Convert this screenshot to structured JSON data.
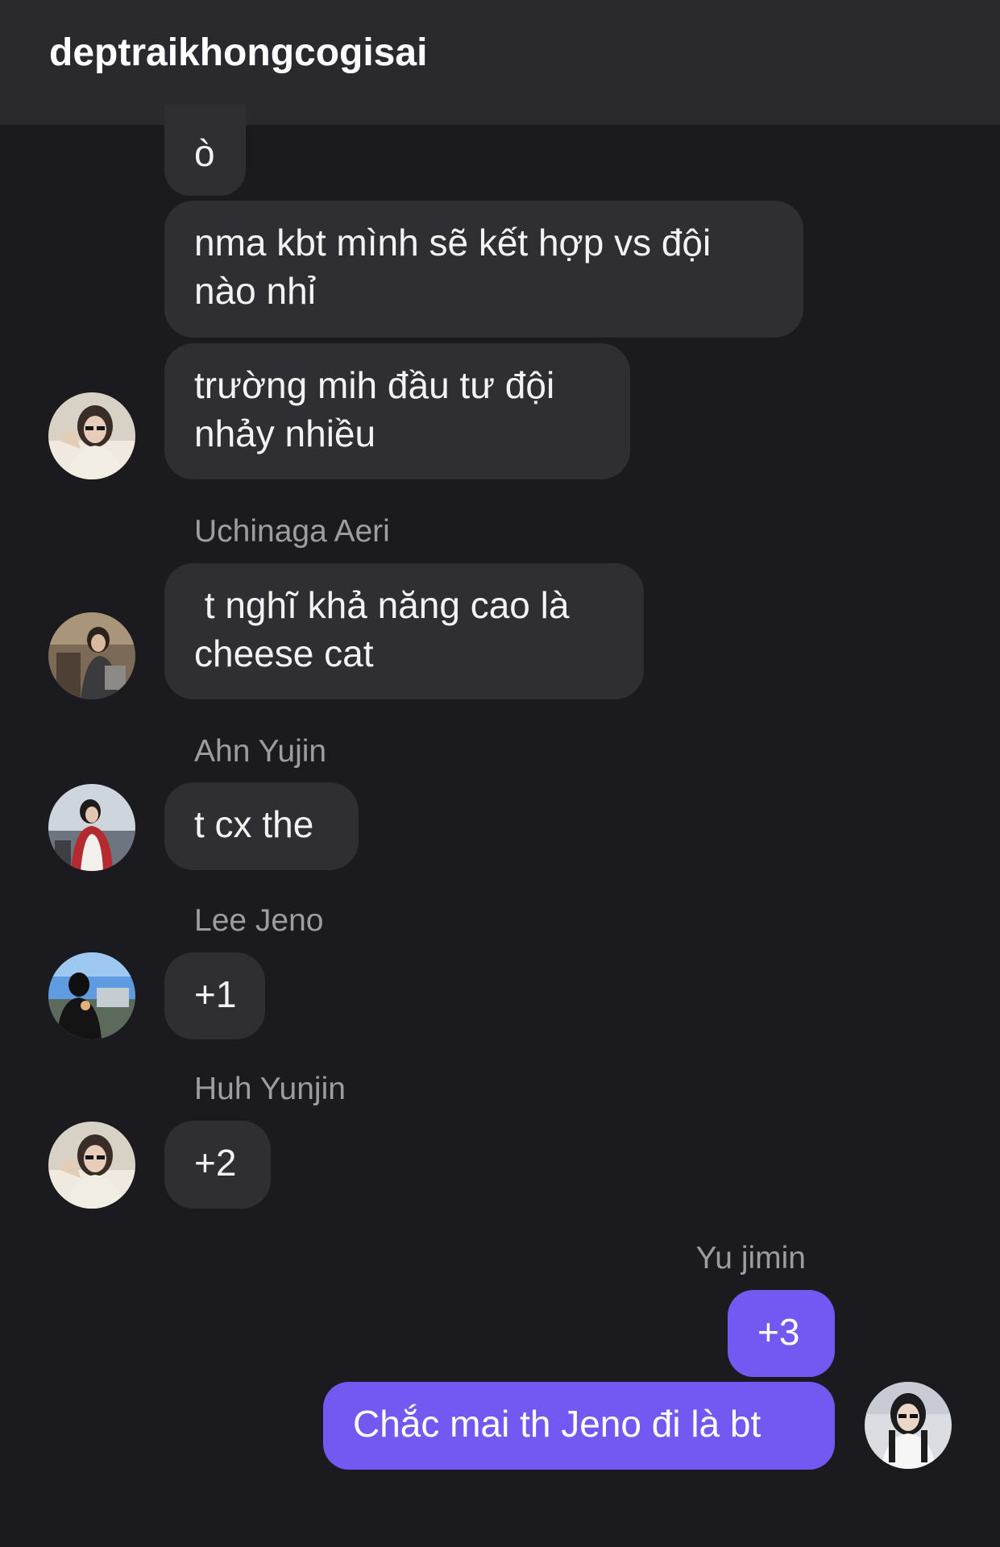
{
  "header": {
    "title": "deptraikhongcogisai"
  },
  "messages": [
    {
      "text": "ò"
    },
    {
      "text": "nma kbt mình sẽ kết hợp vs đội nào nhỉ"
    },
    {
      "text": "trường mih đầu tư đội nhảy nhiều"
    },
    {
      "sender": "Uchinaga Aeri",
      "text": " t nghĩ khả năng cao là cheese cat"
    },
    {
      "sender": "Ahn Yujin",
      "text": "t cx the"
    },
    {
      "sender": "Lee Jeno",
      "text": "+1"
    },
    {
      "sender": "Huh Yunjin",
      "text": "+2"
    },
    {
      "sender": "Yu jimin",
      "text": "+3"
    },
    {
      "text": "Chắc mai th Jeno đi là bt"
    }
  ],
  "colors": {
    "background": "#1b1b1f",
    "header": "#2a2a2e",
    "incoming_bubble": "#2f2f33",
    "outgoing_bubble": "#7458f2",
    "sender_name": "#9c9ca3"
  }
}
